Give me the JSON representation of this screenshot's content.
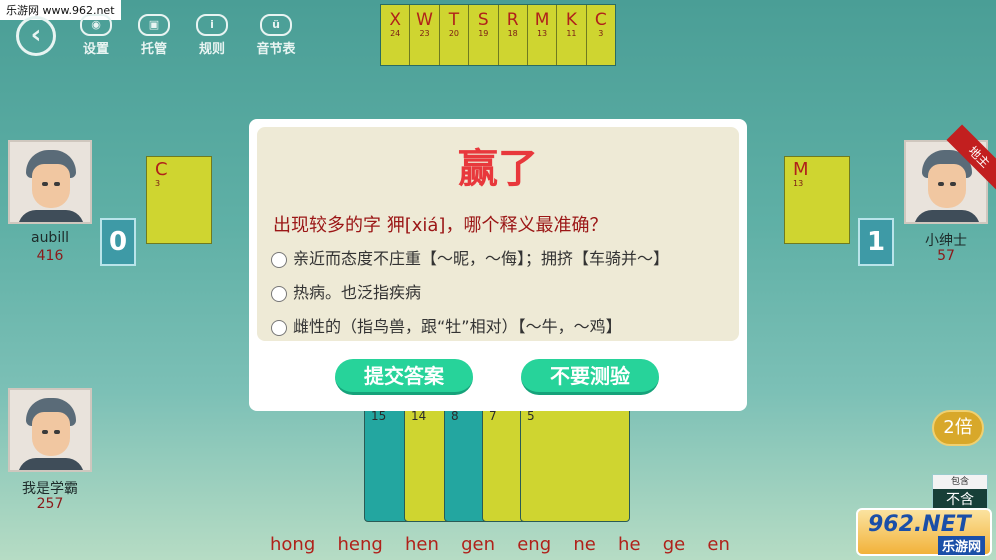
{
  "watermark": {
    "top_left": "乐游网 www.962.net",
    "logo": "962.NET",
    "site": "乐游网"
  },
  "toolbar": {
    "back_icon": "back-arrow-icon",
    "items": [
      {
        "label": "设置",
        "icon": "eye-icon"
      },
      {
        "label": "托管",
        "icon": "robot-icon"
      },
      {
        "label": "规则",
        "icon": "info-icon"
      },
      {
        "label": "音节表",
        "icon": "syllable-icon"
      }
    ]
  },
  "top_cards": [
    {
      "rank": "X",
      "count": "24"
    },
    {
      "rank": "W",
      "count": "23"
    },
    {
      "rank": "T",
      "count": "20"
    },
    {
      "rank": "S",
      "count": "19"
    },
    {
      "rank": "R",
      "count": "18"
    },
    {
      "rank": "M",
      "count": "13"
    },
    {
      "rank": "K",
      "count": "11"
    },
    {
      "rank": "C",
      "count": "3"
    }
  ],
  "players": {
    "left": {
      "name": "aubill",
      "score": "416",
      "cards_left": "0",
      "played": {
        "rank": "C",
        "count": "3"
      }
    },
    "right": {
      "name": "小绅士",
      "score": "57",
      "cards_left": "1",
      "badge": "地主",
      "played": {
        "rank": "M",
        "count": "13"
      }
    },
    "self": {
      "name": "我是学霸",
      "score": "257"
    }
  },
  "hand": [
    {
      "label": "15",
      "color": "#23a6a0"
    },
    {
      "label": "14",
      "color": "#cfd530"
    },
    {
      "label": "8",
      "color": "#23a6a0"
    },
    {
      "label": "7",
      "color": "#cfd530"
    },
    {
      "label": "5",
      "color": "#cfd530"
    }
  ],
  "pinyin": [
    "hong",
    "heng",
    "hen",
    "gen",
    "eng",
    "ne",
    "he",
    "ge",
    "en"
  ],
  "multiplier": "2倍",
  "tax": {
    "label": "包含",
    "value": "不含"
  },
  "dialog": {
    "title": "赢了",
    "question": "出现较多的字 狎[xiá]，哪个释义最准确？",
    "options": [
      "亲近而态度不庄重【～昵，～侮】；拥挤【车骑并～】",
      "热病。也泛指疾病",
      "雌性的（指鸟兽，跟“牡”相对）【～牛，～鸡】"
    ],
    "submit_label": "提交答案",
    "skip_label": "不要测验"
  }
}
